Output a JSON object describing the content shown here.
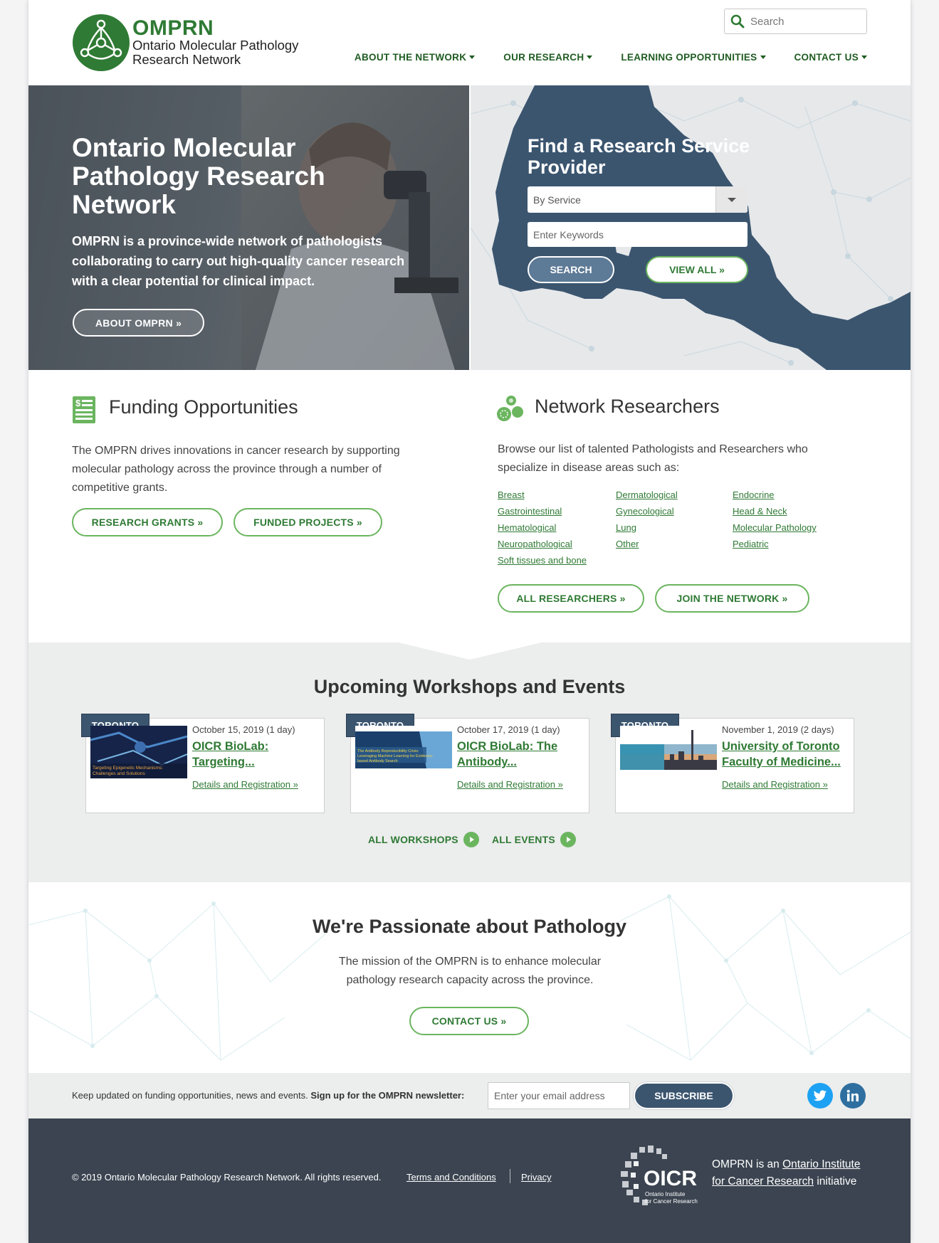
{
  "header": {
    "logo_abbr": "OMPRN",
    "logo_line1": "Ontario Molecular Pathology",
    "logo_line2": "Research Network",
    "search_placeholder": "Search",
    "nav": [
      {
        "label": "ABOUT THE NETWORK"
      },
      {
        "label": "OUR RESEARCH"
      },
      {
        "label": "LEARNING OPPORTUNITIES"
      },
      {
        "label": "CONTACT US"
      }
    ]
  },
  "hero": {
    "title": "Ontario Molecular Pathology Research Network",
    "subtitle": "OMPRN is a province-wide network of pathologists collaborating to carry out high-quality cancer research with a clear potential for clinical impact.",
    "button": "ABOUT OMPRN »"
  },
  "finder": {
    "title": "Find a Research Service Provider",
    "select_value": "By Service",
    "keywords_placeholder": "Enter Keywords",
    "search_button": "SEARCH",
    "view_all_button": "VIEW ALL »"
  },
  "funding": {
    "title": "Funding Opportunities",
    "text": "The OMPRN drives innovations in cancer research by supporting molecular pathology across the province through a number of competitive grants.",
    "btn_grants": "RESEARCH GRANTS »",
    "btn_projects": "FUNDED PROJECTS »"
  },
  "researchers": {
    "title": "Network Researchers",
    "text": "Browse our list of talented Pathologists and Researchers who specialize in disease areas such as:",
    "areas": [
      "Breast",
      "Dermatological",
      "Endocrine",
      "Gastrointestinal",
      "Gynecological",
      "Head & Neck",
      "Hematological",
      "Lung",
      "Molecular Pathology",
      "Neuropathological",
      "Other",
      "Pediatric",
      "Soft tissues and bone"
    ],
    "btn_all": "ALL RESEARCHERS »",
    "btn_join": "JOIN THE NETWORK »"
  },
  "events": {
    "title": "Upcoming Workshops and Events",
    "cards": [
      {
        "tag": "TORONTO",
        "date": "October 15, 2019 (1 day)",
        "title": "OICR BioLab: Targeting...",
        "link": "Details and Registration »",
        "thumb_caption": "Targeting Epigenetic Mechanisms: Challenges and Solutions"
      },
      {
        "tag": "TORONTO",
        "date": "October 17, 2019 (1 day)",
        "title": "OICR BioLab: The Antibody...",
        "link": "Details and Registration »",
        "thumb_caption": "The Antibody Reproducibility Crisis: Leveraging Machine Learning for Evidence-based Antibody Search"
      },
      {
        "tag": "TORONTO",
        "date": "November 1, 2019 (2 days)",
        "title": "University of Toronto Faculty of Medicine...",
        "link": "Details and Registration »",
        "thumb_caption": ""
      }
    ],
    "all_workshops": "ALL WORKSHOPS",
    "all_events": "ALL EVENTS"
  },
  "passion": {
    "title": "We're Passionate about Pathology",
    "text": "The mission of the OMPRN is to enhance molecular pathology research capacity across the province.",
    "button": "CONTACT US »"
  },
  "newsletter": {
    "text": "Keep updated on funding opportunities, news and events. ",
    "bold": "Sign up for the OMPRN newsletter:",
    "placeholder": "Enter your email address",
    "button": "SUBSCRIBE"
  },
  "footer": {
    "copyright": "© 2019 Ontario Molecular Pathology Research Network. All rights reserved.",
    "terms": "Terms and Conditions",
    "privacy": "Privacy",
    "oicr_prefix": "OMPRN is an ",
    "oicr_link": "Ontario Institute for Cancer Research",
    "oicr_suffix": " initiative",
    "oicr_logo_text": "OICR",
    "oicr_logo_sub1": "Ontario Institute",
    "oicr_logo_sub2": "for Cancer Research"
  },
  "colors": {
    "brand_green": "#2f7a34",
    "accent_green": "#6bb55f",
    "navy": "#3b556f",
    "footer": "#3b4450"
  },
  "icons": [
    "search-icon",
    "caret-down-icon",
    "document-dollar-icon",
    "molecule-icon",
    "twitter-icon",
    "linkedin-icon",
    "arrow-right-circle-icon"
  ]
}
